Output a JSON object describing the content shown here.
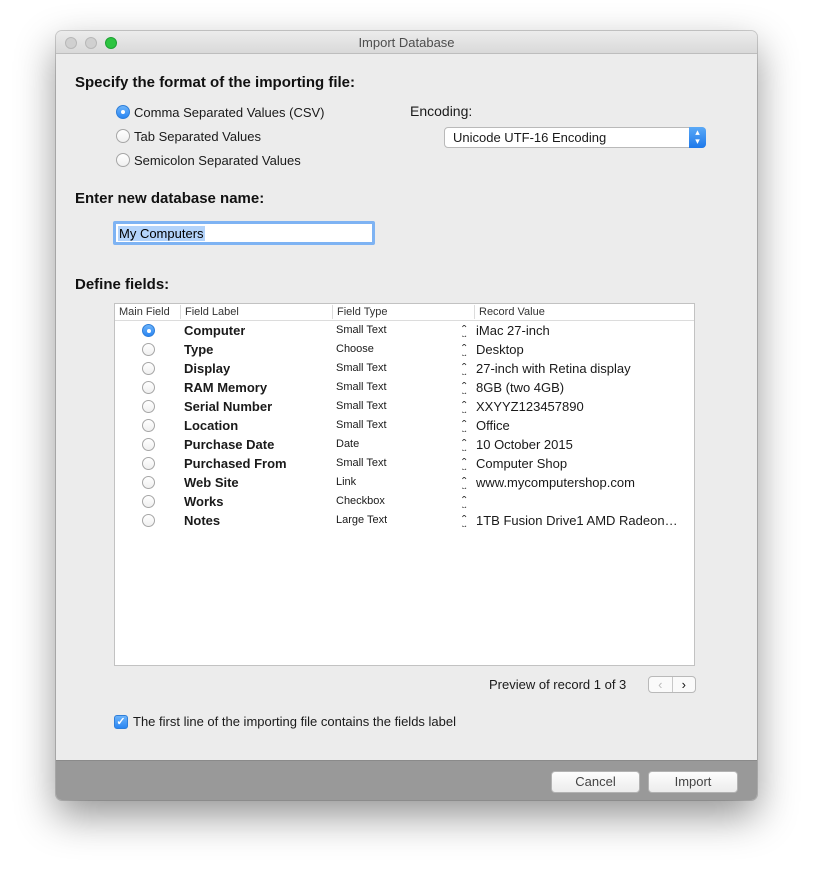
{
  "window": {
    "title": "Import Database"
  },
  "format": {
    "heading": "Specify the format of the importing file:",
    "options": [
      {
        "label": "Comma Separated Values (CSV)",
        "selected": true
      },
      {
        "label": "Tab Separated Values",
        "selected": false
      },
      {
        "label": "Semicolon Separated Values",
        "selected": false
      }
    ],
    "encoding_label": "Encoding:",
    "encoding_value": "Unicode UTF-16 Encoding"
  },
  "database": {
    "heading": "Enter new database name:",
    "name_value": "My Computers"
  },
  "fields": {
    "heading": "Define fields:",
    "columns": [
      "Main Field",
      "Field Label",
      "Field Type",
      "Record Value"
    ],
    "rows": [
      {
        "main": true,
        "label": "Computer",
        "type": "Small Text",
        "value": "iMac 27-inch"
      },
      {
        "main": false,
        "label": "Type",
        "type": "Choose",
        "value": "Desktop"
      },
      {
        "main": false,
        "label": "Display",
        "type": "Small Text",
        "value": "27-inch with Retina display"
      },
      {
        "main": false,
        "label": "RAM Memory",
        "type": "Small Text",
        "value": "8GB (two 4GB)"
      },
      {
        "main": false,
        "label": "Serial Number",
        "type": "Small Text",
        "value": "XXYYZ123457890"
      },
      {
        "main": false,
        "label": "Location",
        "type": "Small Text",
        "value": "Office"
      },
      {
        "main": false,
        "label": "Purchase Date",
        "type": "Date",
        "value": "10 October 2015"
      },
      {
        "main": false,
        "label": "Purchased From",
        "type": "Small Text",
        "value": "Computer Shop"
      },
      {
        "main": false,
        "label": "Web Site",
        "type": "Link",
        "value": "www.mycomputershop.com"
      },
      {
        "main": false,
        "label": "Works",
        "type": "Checkbox",
        "value": ""
      },
      {
        "main": false,
        "label": "Notes",
        "type": "Large Text",
        "value": "1TB Fusion Drive1 AMD Radeon…"
      }
    ]
  },
  "preview": {
    "text": "Preview of record 1 of 3",
    "prev_glyph": "‹",
    "next_glyph": "›"
  },
  "first_line": {
    "label": "The first line of the importing file contains the fields label",
    "checked": true
  },
  "buttons": {
    "cancel": "Cancel",
    "import": "Import"
  },
  "colors": {
    "accent": "#2a86f3",
    "footer": "#999999",
    "window_bg": "#ececec"
  }
}
